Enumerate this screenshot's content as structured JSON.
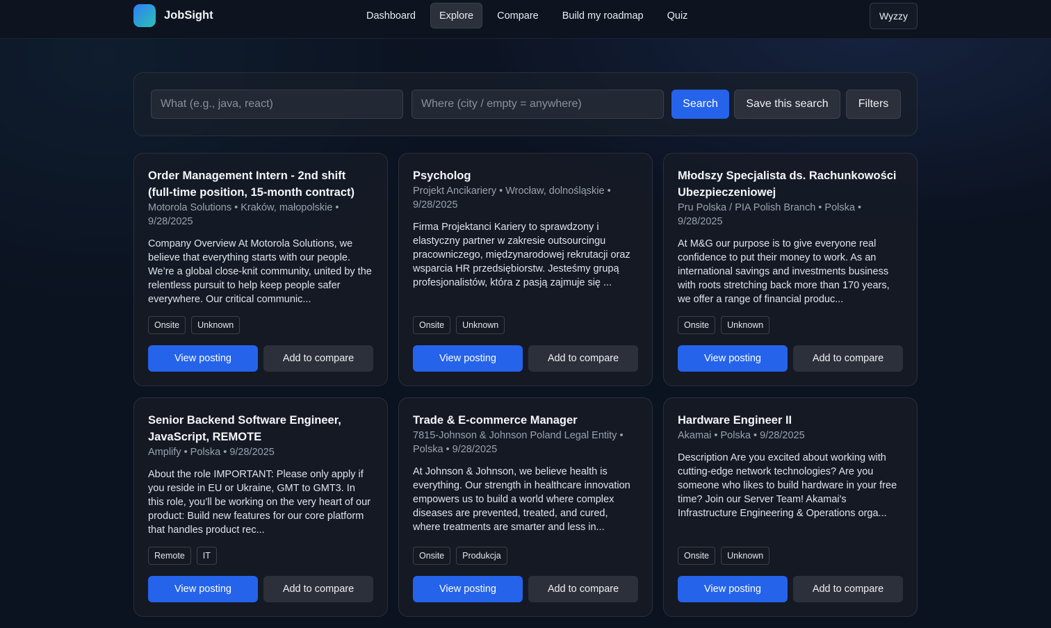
{
  "app": {
    "name": "JobSight"
  },
  "nav": {
    "items": [
      {
        "label": "Dashboard",
        "active": false
      },
      {
        "label": "Explore",
        "active": true
      },
      {
        "label": "Compare",
        "active": false
      },
      {
        "label": "Build my roadmap",
        "active": false
      },
      {
        "label": "Quiz",
        "active": false
      }
    ],
    "user_label": "Wyzzy"
  },
  "search": {
    "what_placeholder": "What (e.g., java, react)",
    "what_value": "",
    "where_placeholder": "Where (city / empty = anywhere)",
    "where_value": "",
    "search_label": "Search",
    "save_label": "Save this search",
    "filters_label": "Filters"
  },
  "colors": {
    "accent": "#2563eb",
    "background": "#0b1220",
    "card": "#161b26"
  },
  "jobs": [
    {
      "title": "Order Management Intern - 2nd shift (full-time position, 15-month contract)",
      "meta_line1": "Motorola Solutions • Kraków, małopolskie •",
      "meta_line2": "9/28/2025",
      "description": "Company Overview At Motorola Solutions, we believe that everything starts with our people. We’re a global close-knit community, united by the relentless pursuit to help keep people safer everywhere. Our critical communic...",
      "tags": [
        "Onsite",
        "Unknown"
      ],
      "view_label": "View posting",
      "compare_label": "Add to compare"
    },
    {
      "title": "Psycholog",
      "meta_line1": "Projekt Ancikariery • Wrocław, dolnośląskie •",
      "meta_line2": "9/28/2025",
      "description": "Firma Projektanci Kariery to sprawdzony i elastyczny partner w zakresie outsourcingu pracowniczego, międzynarodowej rekrutacji oraz wsparcia HR przedsiębiorstw. Jesteśmy grupą profesjonalistów, która z pasją zajmuje się ...",
      "tags": [
        "Onsite",
        "Unknown"
      ],
      "view_label": "View posting",
      "compare_label": "Add to compare"
    },
    {
      "title": "Młodszy Specjalista ds. Rachunkowości Ubezpieczeniowej",
      "meta_line1": "Pru Polska / PIA Polish Branch • Polska •",
      "meta_line2": "9/28/2025",
      "description": "At M&G our purpose is to give everyone real confidence to put their money to work. As an international savings and investments business with roots stretching back more than 170 years, we offer a range of financial produc...",
      "tags": [
        "Onsite",
        "Unknown"
      ],
      "view_label": "View posting",
      "compare_label": "Add to compare"
    },
    {
      "title": "Senior Backend Software Engineer, JavaScript, REMOTE",
      "meta_line1": "Amplify • Polska • 9/28/2025",
      "meta_line2": "",
      "description": "About the role IMPORTANT: Please only apply if you reside in EU or Ukraine, GMT to GMT3. In this role, you’ll be working on the very heart of our product: Build new features for our core platform that handles product rec...",
      "tags": [
        "Remote",
        "IT"
      ],
      "view_label": "View posting",
      "compare_label": "Add to compare"
    },
    {
      "title": "Trade & E-commerce Manager",
      "meta_line1": "7815-Johnson & Johnson Poland Legal Entity •",
      "meta_line2": "Polska • 9/28/2025",
      "description": "At Johnson & Johnson, we believe health is everything. Our strength in healthcare innovation empowers us to build a world where complex diseases are prevented, treated, and cured, where treatments are smarter and less in...",
      "tags": [
        "Onsite",
        "Produkcja"
      ],
      "view_label": "View posting",
      "compare_label": "Add to compare"
    },
    {
      "title": "Hardware Engineer II",
      "meta_line1": "Akamai • Polska • 9/28/2025",
      "meta_line2": "",
      "description": "Description Are you excited about working with cutting-edge network technologies? Are you someone who likes to build hardware in your free time? Join our Server Team! Akamai's Infrastructure Engineering & Operations orga...",
      "tags": [
        "Onsite",
        "Unknown"
      ],
      "view_label": "View posting",
      "compare_label": "Add to compare"
    }
  ]
}
